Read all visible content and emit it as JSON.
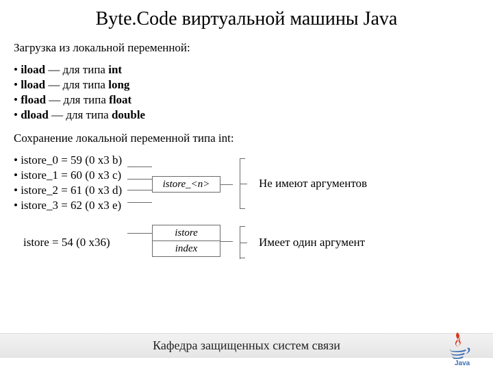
{
  "title": "Byte.Code виртуальной машины Java",
  "section1": "Загрузка из локальной переменной:",
  "loads": {
    "i": {
      "op": "iload",
      "desc": " — для типа ",
      "type": "int"
    },
    "l": {
      "op": "lload",
      "desc": " — для типа ",
      "type": "long"
    },
    "f": {
      "op": "fload",
      "desc": " — для типа ",
      "type": "float"
    },
    "d": {
      "op": "dload",
      "desc": " — для типа ",
      "type": "double"
    }
  },
  "section2": "Сохранение локальной переменной типа int:",
  "istoreN": {
    "i0": "• istore_0 = 59 (0 x3 b)",
    "i1": "• istore_1 = 60 (0 x3 c)",
    "i2": "• istore_2 = 61 (0 x3 d)",
    "i3": "• istore_3 = 62 (0 x3 e)"
  },
  "diagram1_label": "istore_<n>",
  "caption1": "Не имеют аргументов",
  "istore": "istore = 54 (0 x36)",
  "d2_top": "istore",
  "d2_bot": "index",
  "caption2": "Имеет один аргумент",
  "footer": "Кафедра защищенных систем связи"
}
